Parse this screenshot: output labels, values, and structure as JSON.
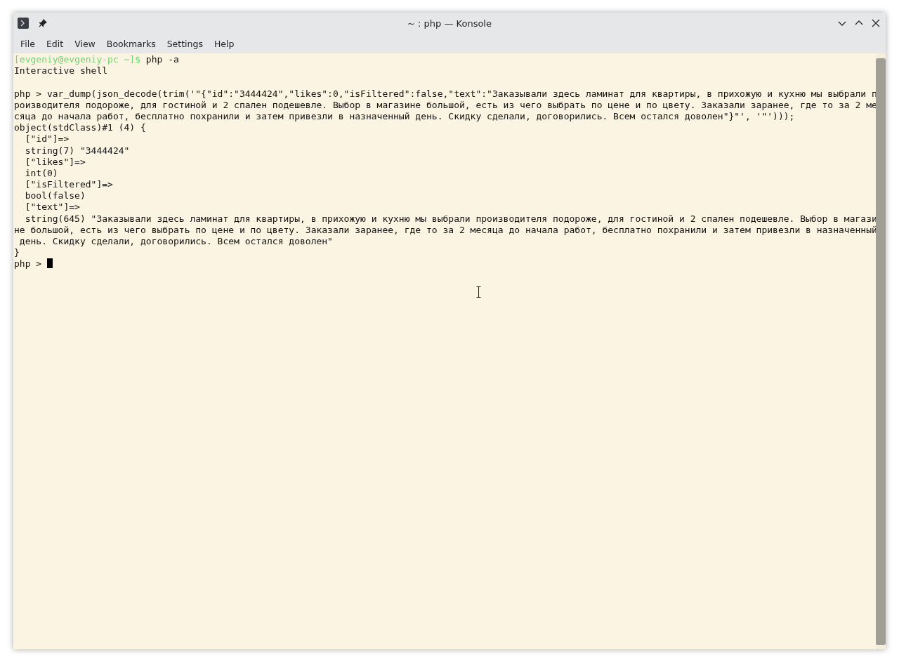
{
  "window": {
    "title": "~ : php — Konsole"
  },
  "menu": [
    "File",
    "Edit",
    "View",
    "Bookmarks",
    "Settings",
    "Help"
  ],
  "terminal": {
    "lines": [
      {
        "kind": "prompt",
        "prompt": "[evgeniy@evgeniy-pc ~]$",
        "command": "php -a"
      },
      {
        "kind": "output",
        "text": "Interactive shell"
      },
      {
        "kind": "blank"
      },
      {
        "kind": "output",
        "text": "php > var_dump(json_decode(trim('\"{\"id\":\"3444424\",\"likes\":0,\"isFiltered\":false,\"text\":\"Заказывали здесь ламинат для квартиры, в прихожую и кухню мы выбрали п"
      },
      {
        "kind": "output",
        "text": "роизводителя подороже, для гостиной и 2 спален подешевле. Выбор в магазине большой, есть из чего выбрать по цене и по цвету. Заказали заранее, где то за 2 ме"
      },
      {
        "kind": "output",
        "text": "сяца до начала работ, бесплатно похранили и затем привезли в назначенный день. Скидку сделали, договорились. Всем остался доволен\"}\"', '\"')));"
      },
      {
        "kind": "output",
        "text": "object(stdClass)#1 (4) {"
      },
      {
        "kind": "output",
        "text": "  [\"id\"]=>"
      },
      {
        "kind": "output",
        "text": "  string(7) \"3444424\""
      },
      {
        "kind": "output",
        "text": "  [\"likes\"]=>"
      },
      {
        "kind": "output",
        "text": "  int(0)"
      },
      {
        "kind": "output",
        "text": "  [\"isFiltered\"]=>"
      },
      {
        "kind": "output",
        "text": "  bool(false)"
      },
      {
        "kind": "output",
        "text": "  [\"text\"]=>"
      },
      {
        "kind": "output",
        "text": "  string(645) \"Заказывали здесь ламинат для квартиры, в прихожую и кухню мы выбрали производителя подороже, для гостиной и 2 спален подешевле. Выбор в магази"
      },
      {
        "kind": "output",
        "text": "не большой, есть из чего выбрать по цене и по цвету. Заказали заранее, где то за 2 месяца до начала работ, бесплатно похранили и затем привезли в назначенный"
      },
      {
        "kind": "output",
        "text": " день. Скидку сделали, договорились. Всем остался доволен\""
      },
      {
        "kind": "output",
        "text": "}"
      },
      {
        "kind": "input",
        "text": "php >",
        "cursor": true
      }
    ]
  }
}
